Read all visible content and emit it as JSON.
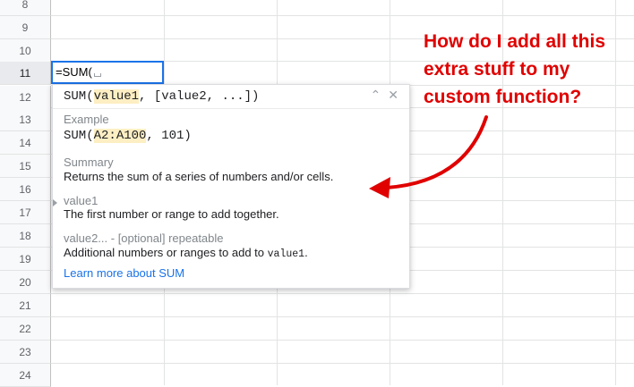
{
  "rows": [
    "8",
    "9",
    "10",
    "11",
    "12",
    "13",
    "14",
    "15",
    "16",
    "17",
    "18",
    "19",
    "20",
    "21",
    "22",
    "23",
    "24"
  ],
  "active_row": "11",
  "cell": {
    "formula": "=SUM("
  },
  "popup": {
    "sig_prefix": "SUM(",
    "sig_param": "value1",
    "sig_rest": ", [value2, ...])",
    "collapse_icon": "chevron-up",
    "close_icon": "close",
    "example_label": "Example",
    "example_prefix": "SUM(",
    "example_range": "A2:A100",
    "example_rest": ", 101)",
    "summary_label": "Summary",
    "summary_text": "Returns the sum of a series of numbers and/or cells.",
    "param1_name": "value1",
    "param1_desc": "The first number or range to add together.",
    "param2_name": "value2... - [optional] repeatable",
    "param2_desc_prefix": "Additional numbers or ranges to add to ",
    "param2_desc_code": "value1",
    "param2_desc_suffix": ".",
    "learn_more": "Learn more about SUM"
  },
  "annotation": {
    "line1": "How do I add all this",
    "line2": "extra stuff to my",
    "line3": "custom function?",
    "color": "#e00000"
  }
}
